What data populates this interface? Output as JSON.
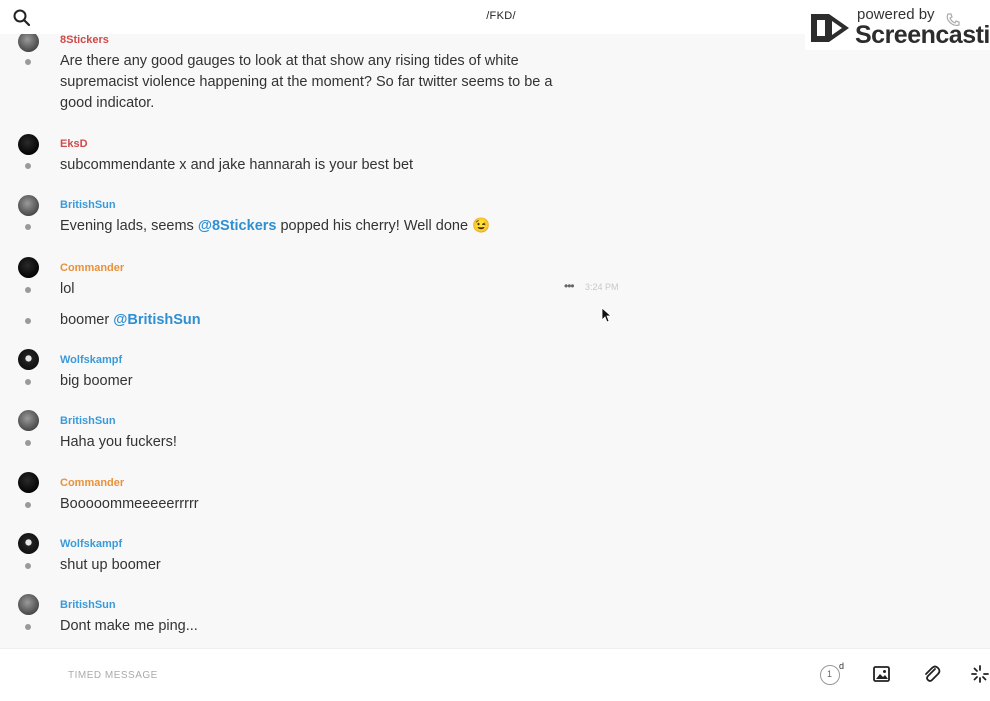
{
  "header": {
    "channel": "/FKD/",
    "watermark": {
      "powered": "powered by",
      "brand": "Screencastify"
    }
  },
  "messages": [
    {
      "user": "8Stickers",
      "user_color": "#d04a4a",
      "avatar": "av-grey",
      "lines": [
        "Are there any good gauges to look at that show any rising tides of white supremacist violence happening at the moment? So far twitter seems to be a good indicator."
      ]
    },
    {
      "user": "EksD",
      "user_color": "#d04a4a",
      "avatar": "av-black",
      "lines": [
        "subcommendante x and jake hannarah is your best bet"
      ]
    },
    {
      "user": "BritishSun",
      "user_color": "#3a9ad9",
      "avatar": "av-grey",
      "line_pre": "Evening lads, seems ",
      "mention": "@8Stickers",
      "line_post": " popped his cherry! Well done 😉"
    },
    {
      "user": "Commander",
      "user_color": "#e8913a",
      "avatar": "av-black",
      "first_line": "lol",
      "time": "3:24 PM",
      "second_pre": "boomer ",
      "second_mention": "@BritishSun"
    },
    {
      "user": "Wolfskampf",
      "user_color": "#3a9ad9",
      "avatar": "av-wolf",
      "lines": [
        "big boomer"
      ]
    },
    {
      "user": "BritishSun",
      "user_color": "#3a9ad9",
      "avatar": "av-grey",
      "lines": [
        "Haha you fuckers!"
      ]
    },
    {
      "user": "Commander",
      "user_color": "#e8913a",
      "avatar": "av-black",
      "lines": [
        "Booooommeeeeerrrrr"
      ]
    },
    {
      "user": "Wolfskampf",
      "user_color": "#3a9ad9",
      "avatar": "av-wolf",
      "lines": [
        "shut up boomer"
      ]
    },
    {
      "user": "BritishSun",
      "user_color": "#3a9ad9",
      "avatar": "av-grey",
      "lines": [
        "Dont make me ping..."
      ]
    }
  ],
  "composer": {
    "placeholder": "TIMED MESSAGE",
    "timer_value": "1",
    "timer_unit": "d"
  },
  "icons": [
    "search-icon",
    "phone-icon",
    "info-icon",
    "image-icon",
    "paperclip-icon",
    "sparkle-icon",
    "screencastify-logo-icon"
  ],
  "colors": {
    "mention": "#2f8fd3",
    "red_user": "#d04a4a",
    "blue_user": "#3a9ad9",
    "orange_user": "#e8913a"
  }
}
